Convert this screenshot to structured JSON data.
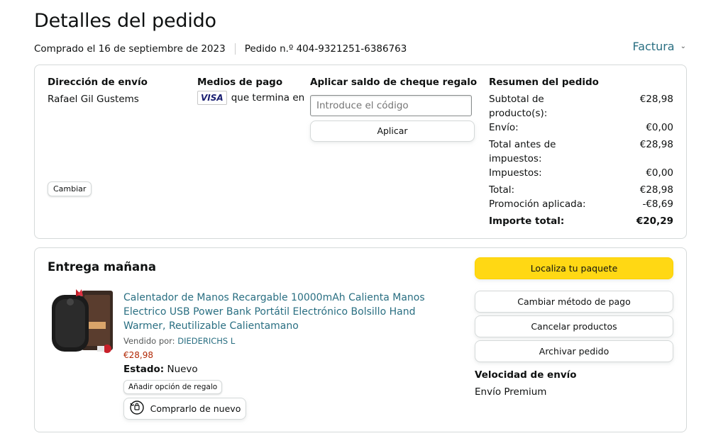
{
  "page_title": "Detalles del pedido",
  "meta": {
    "purchased": "Comprado el 16 de septiembre de 2023",
    "order": "Pedido n.º 404-9321251-6386763"
  },
  "invoice_label": "Factura",
  "shipping": {
    "heading": "Dirección de envío",
    "name": "Rafael Gil Gustems",
    "change_label": "Cambiar"
  },
  "payment": {
    "heading": "Medios de pago",
    "card_brand": "VISA",
    "card_text": "que termina en"
  },
  "gift": {
    "heading": "Aplicar saldo de cheque regalo",
    "placeholder": "Introduce el código",
    "apply_label": "Aplicar"
  },
  "summary": {
    "heading": "Resumen del pedido",
    "rows": [
      {
        "label": "Subtotal de producto(s):",
        "value": "€28,98"
      },
      {
        "label": "Envío:",
        "value": "€0,00"
      },
      {
        "label": "Total antes de impuestos:",
        "value": "€28,98"
      },
      {
        "label": "Impuestos:",
        "value": "€0,00"
      },
      {
        "label": "Total:",
        "value": "€28,98"
      },
      {
        "label": "Promoción aplicada:",
        "value": "-€8,69"
      },
      {
        "label": "Importe total:",
        "value": "€20,29"
      }
    ]
  },
  "delivery": {
    "heading": "Entrega mañana",
    "product_title": "Calentador de Manos Recargable 10000mAh Calienta Manos Electrico USB Power Bank Portátil Electrónico Bolsillo Hand Warmer, Reutilizable Calientamano",
    "seller_label": "Vendido por:",
    "seller_name": "DIEDERICHS L",
    "price": "€28,98",
    "state_label": "Estado:",
    "state_value": "Nuevo",
    "gift_option_label": "Añadir opción de regalo",
    "buy_again_label": "Comprarlo de nuevo"
  },
  "actions": {
    "track": "Localiza tu paquete",
    "change_payment": "Cambiar método de pago",
    "cancel": "Cancelar productos",
    "archive": "Archivar pedido"
  },
  "shipping_speed": {
    "heading": "Velocidad de envío",
    "value": "Envío Premium"
  },
  "colors": {
    "link": "#2a6f82",
    "price": "#b12704",
    "primary_button": "#ffd814",
    "border": "#d5d9d9"
  }
}
